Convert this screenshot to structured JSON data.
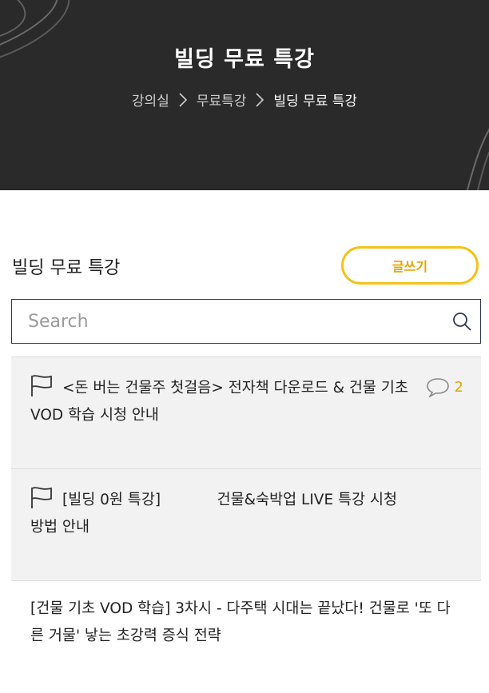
{
  "header": {
    "title": "빌딩 무료 특강",
    "breadcrumb": [
      "강의실",
      "무료특강",
      "빌딩 무료 특강"
    ]
  },
  "board": {
    "title": "빌딩 무료 특강",
    "write_label": "글쓰기",
    "search_placeholder": "Search"
  },
  "posts": [
    {
      "type": "notice",
      "title": "<돈 버는 건물주 첫걸음> 전자책 다운로드 & 건물 기초 VOD 학습 시청 안내",
      "comments": "2"
    },
    {
      "type": "notice",
      "title": "[빌딩 0원 특강]            건물&숙박업 LIVE 특강 시청 방법 안내"
    },
    {
      "type": "normal",
      "title": "[건물 기초 VOD 학습] 3차시 - 다주택 시대는 끝났다! 건물로 '또 다른 거물' 낳는 초강력 증식 전략"
    }
  ],
  "colors": {
    "hero_bg": "#2a2a2a",
    "accent": "#f2c318",
    "accent_text": "#e3a600",
    "search_border": "#2d3954"
  }
}
